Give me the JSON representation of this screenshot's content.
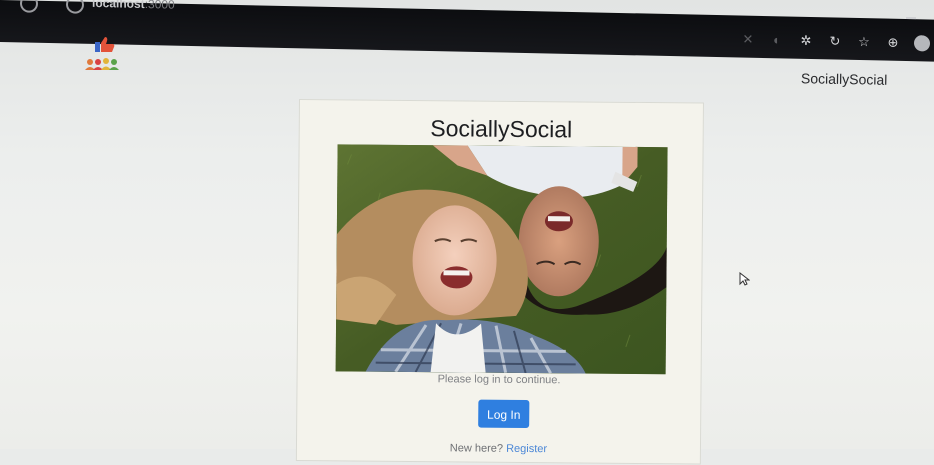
{
  "browser": {
    "url_host": "localhost",
    "url_port": ":3000"
  },
  "header": {
    "brand": "SociallySocial"
  },
  "card": {
    "title": "SociallySocial",
    "caption": "Please log in to continue.",
    "login_label": "Log In",
    "register_prompt": "New here?",
    "register_link": "Register"
  },
  "icons": {
    "logo": "thumbs-up-people-logo-icon",
    "cursor": "mouse-pointer-icon"
  },
  "colors": {
    "primary_button": "#2f7fe0",
    "link": "#4a86d6"
  }
}
